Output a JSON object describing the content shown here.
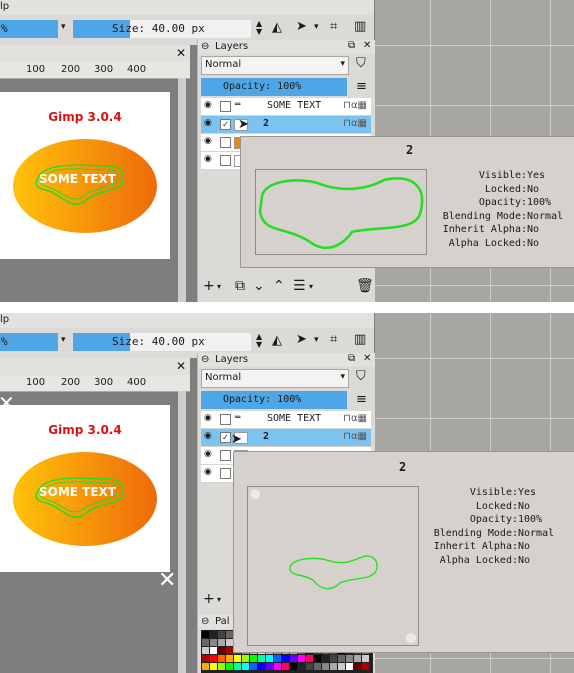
{
  "panels": [
    {
      "menu_text": "lp",
      "opacity_left_text": "%",
      "size_field": "Size: 40.00 px",
      "ruler_ticks": [
        "100",
        "200",
        "300",
        "400"
      ],
      "image_title": "Gimp 3.0.4",
      "image_text": "SOME TEXT",
      "layers_title": "Layers",
      "mode": "Normal",
      "opacity": "Opacity:  100%",
      "layers": [
        {
          "name": "SOME TEXT",
          "selected": false,
          "visible_check": false
        },
        {
          "name": "2",
          "selected": true,
          "visible_check": true
        },
        {
          "name": "",
          "selected": false,
          "visible_check": false
        },
        {
          "name": "",
          "selected": false,
          "visible_check": false
        }
      ],
      "tooltip": {
        "title": "2",
        "visible": "Yes",
        "locked": "No",
        "opacity": "100%",
        "blending_mode": "Normal",
        "inherit_alpha": "No",
        "alpha_locked": "No"
      }
    },
    {
      "menu_text": "lp",
      "opacity_left_text": "%",
      "size_field": "Size: 40.00 px",
      "ruler_ticks": [
        "100",
        "200",
        "300",
        "400"
      ],
      "image_title": "Gimp 3.0.4",
      "image_text": "SOME TEXT",
      "layers_title": "Layers",
      "mode": "Normal",
      "opacity": "Opacity:  100%",
      "palette_label": "Pal",
      "layers": [
        {
          "name": "SOME TEXT",
          "selected": false,
          "visible_check": false
        },
        {
          "name": "2",
          "selected": true,
          "visible_check": true
        },
        {
          "name": "",
          "selected": false,
          "visible_check": false
        },
        {
          "name": "",
          "selected": false,
          "visible_check": false
        }
      ],
      "tooltip": {
        "title": "2",
        "visible": "Yes",
        "locked": "No",
        "opacity": "100%",
        "blending_mode": "Normal",
        "inherit_alpha": "No",
        "alpha_locked": "No"
      }
    }
  ],
  "labels": {
    "visible": "Visible:",
    "locked": "Locked:",
    "opacity": "Opacity:",
    "blending_mode": "Blending Mode:",
    "inherit_alpha": "Inherit Alpha:",
    "alpha_locked": "Alpha Locked:"
  },
  "colors": {
    "accent_blue": "#4ea6e6",
    "selected_row": "#7cc3ef",
    "outline_green": "#22dd22",
    "title_red": "#dd1111",
    "gradient_start": "#ffc20a",
    "gradient_end": "#ee6a0a"
  }
}
